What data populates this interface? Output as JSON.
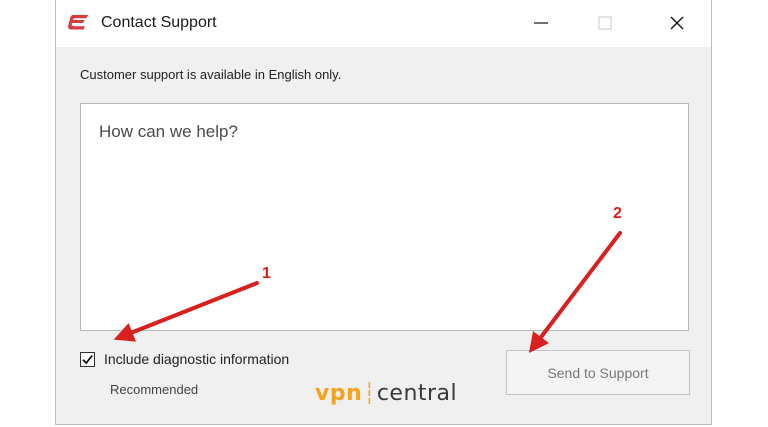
{
  "window": {
    "title": "Contact Support",
    "controls": [
      "minimize",
      "maximize",
      "close"
    ]
  },
  "subtitle": "Customer support is available in English only.",
  "message": {
    "placeholder": "How can we help?",
    "value": ""
  },
  "diagnostics": {
    "label": "Include diagnostic information",
    "checked": true,
    "hint": "Recommended"
  },
  "send_button": {
    "label": "Send to Support",
    "enabled": false
  },
  "watermark": {
    "part1": "vpn",
    "part2": "central"
  },
  "annotations": {
    "marker1": "1",
    "marker2": "2"
  },
  "colors": {
    "brand": "#da3940",
    "annotation": "#d8201f",
    "watermark_accent": "#f7a21b"
  }
}
